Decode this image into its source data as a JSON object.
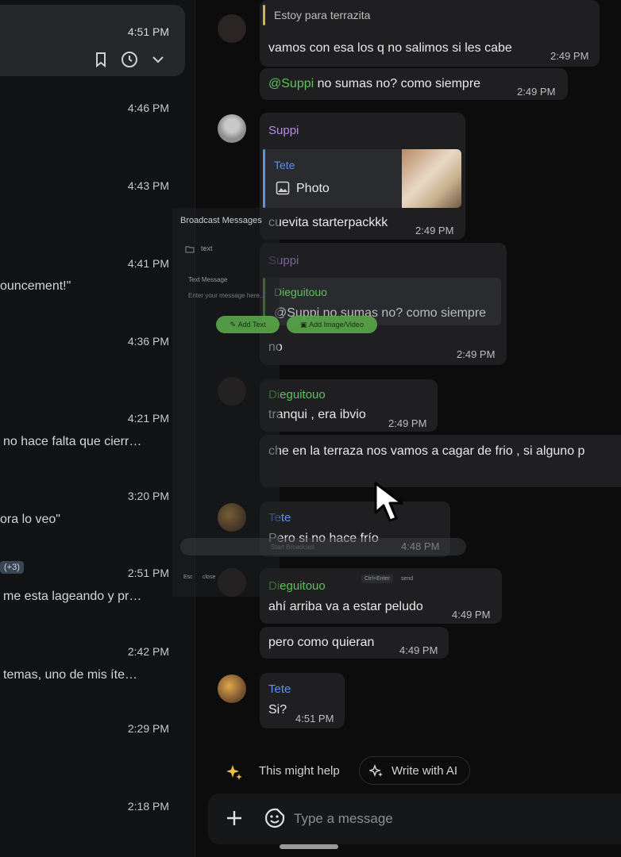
{
  "chat_list": {
    "selected": {
      "time": "4:51 PM"
    },
    "rows": [
      {
        "time": "4:46 PM",
        "preview": ""
      },
      {
        "time": "4:43 PM",
        "preview": ""
      },
      {
        "time": "4:41 PM",
        "preview": "ouncement!\""
      },
      {
        "time": "4:36 PM",
        "preview": ""
      },
      {
        "time": "4:21 PM",
        "preview": "no hace falta que cierr…"
      },
      {
        "time": "3:20 PM",
        "preview": "ora lo veo\""
      },
      {
        "time": "2:51 PM",
        "preview": "me esta lageando y pr…"
      },
      {
        "time": "2:42 PM",
        "preview": "temas, uno de mis íte…"
      },
      {
        "time": "2:29 PM",
        "preview": ""
      },
      {
        "time": "2:18 PM",
        "preview": ""
      }
    ],
    "badge": "(+3)"
  },
  "messages": {
    "m1_quote": "Estoy para terrazita",
    "m1_text": "vamos con esa los q no salimos si les cabe",
    "m1_time": "2:49 PM",
    "m2_mention": "@Suppi",
    "m2_text": " no sumas no? como siempre",
    "m2_time": "2:49 PM",
    "m3_name": "Suppi",
    "m3_reply_name": "Tete",
    "m3_reply_text": "Photo",
    "m3_text": "cuevita starterpackkk",
    "m3_time": "2:49 PM",
    "m4_name": "Suppi",
    "m4_reply_name": "Dieguitouo",
    "m4_reply_text": "@Suppi no sumas no? como siempre",
    "m4_text": "no",
    "m4_time": "2:49 PM",
    "m5_name": "Dieguitouo",
    "m5_text": "tranqui , era ibvio",
    "m5_time": "2:49 PM",
    "m6_text": "che en la terraza nos vamos a cagar de frio , si alguno p",
    "m7_name": "Tete",
    "m7_text": "Pero si no hace frío",
    "m7_time": "4:48 PM",
    "m8_name": "Dieguitouo",
    "m8_text": "ahí arriba va a estar peludo",
    "m8_time": "4:49 PM",
    "m9_text": "pero como quieran",
    "m9_time": "4:49 PM",
    "m10_name": "Tete",
    "m10_text": "Si?",
    "m10_time": "4:51 PM"
  },
  "overlay": {
    "title": "Broadcast Messages",
    "tab": "text",
    "field_label": "Text Message",
    "field_placeholder": "Enter your message here...",
    "add_text": "Add Text",
    "add_media": "Add Image/Video",
    "start": "Start Broadcast",
    "esc": "Esc",
    "close": "close",
    "ctrl_enter": "Ctrl+Enter",
    "send": "send"
  },
  "composer": {
    "suggest_label": "This might help",
    "write_ai": "Write with AI",
    "placeholder": "Type a message"
  },
  "colors": {
    "green": "#5cc15a",
    "purple": "#b48ee6",
    "blue": "#5b8ff0",
    "quote_yellow": "#d4b04a"
  }
}
